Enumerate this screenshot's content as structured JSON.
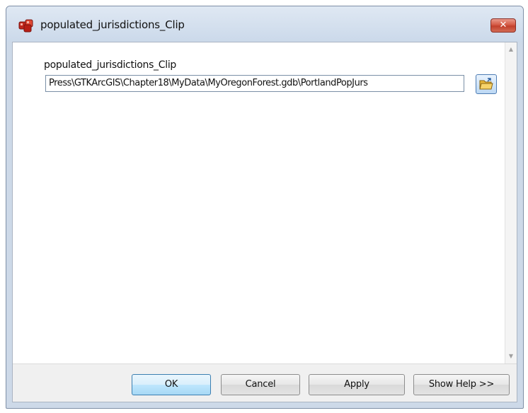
{
  "window": {
    "title": "populated_jurisdictions_Clip",
    "close_label": "✕"
  },
  "parameter": {
    "label": "populated_jurisdictions_Clip",
    "value": "Press\\GTKArcGIS\\Chapter18\\MyData\\MyOregonForest.gdb\\PortlandPopJurs"
  },
  "buttons": {
    "ok": "OK",
    "cancel": "Cancel",
    "apply": "Apply",
    "show_help": "Show Help >>"
  },
  "icons": {
    "app": "model-tool-icon",
    "browse": "open-folder-icon"
  },
  "colors": {
    "accent": "#3c7fb1",
    "close": "#c2402c",
    "window_frame": "#cdd9e8"
  }
}
